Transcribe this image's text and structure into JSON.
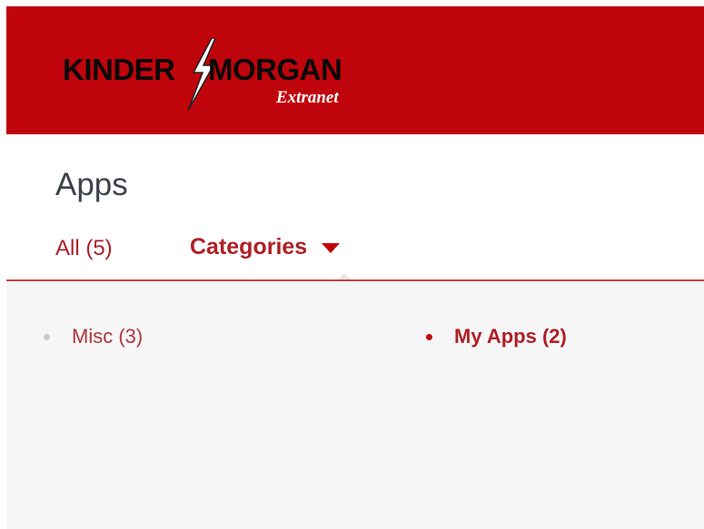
{
  "brand": {
    "name_left": "KINDER",
    "name_right": "MORGAN",
    "subtitle": "Extranet",
    "header_color": "#c0040b"
  },
  "page": {
    "title": "Apps"
  },
  "tabs": {
    "all": "All (5)",
    "categories": "Categories",
    "active": "categories"
  },
  "categories": [
    {
      "label": "Misc (3)",
      "selected": false
    },
    {
      "label": "My Apps (2)",
      "selected": true
    }
  ],
  "colors": {
    "accent": "#b01e26",
    "divider": "#c8434a",
    "content_bg": "#f6f6f6"
  },
  "icons": {
    "logo_bolt": "lightning-bolt-icon",
    "dropdown": "caret-down-icon"
  }
}
